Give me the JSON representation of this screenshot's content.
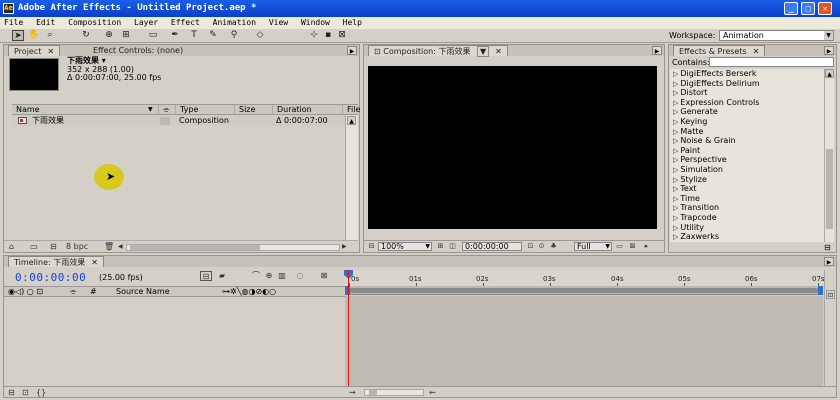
{
  "window": {
    "title": "Adobe After Effects - Untitled Project.aep *",
    "controls": [
      "minimize",
      "maximize",
      "close"
    ]
  },
  "menu": [
    "File",
    "Edit",
    "Composition",
    "Layer",
    "Effect",
    "Animation",
    "View",
    "Window",
    "Help"
  ],
  "toolbar": {
    "tools": [
      "selection-tool",
      "hand-tool",
      "zoom-tool",
      "rotation-tool",
      "orbit-camera-tool",
      "pan-behind-tool",
      "rectangle-mask-tool",
      "pen-tool",
      "text-tool",
      "brush-tool",
      "clone-stamp-tool",
      "eraser-tool",
      "axis-mode-local",
      "axis-mode-world",
      "axis-mode-view"
    ],
    "workspace_label": "Workspace:",
    "workspace_value": "Animation"
  },
  "project_panel": {
    "tab_project": "Project",
    "tab_effect_controls": "Effect Controls: (none)",
    "selected_name": "下雨效果 ▾",
    "selected_size": "352 x 288 (1.00)",
    "selected_duration": "Δ 0:00:07:00, 25.00 fps",
    "columns": [
      "Name",
      "Type",
      "Size",
      "Duration",
      "File"
    ],
    "items": [
      {
        "name": "下雨效果",
        "type": "Composition",
        "size": "",
        "duration": "Δ 0:00:07:00"
      }
    ],
    "bit_depth": "8 bpc"
  },
  "composition_panel": {
    "tab": "Composition: 下雨效果",
    "zoom": "100%",
    "timecode": "0:00:00:00",
    "resolution": "Full"
  },
  "effects_panel": {
    "tab": "Effects & Presets",
    "contains_label": "Contains:",
    "contains_value": "",
    "items": [
      "DigiEffects Berserk",
      "DigiEffects Delirium",
      "Distort",
      "Expression Controls",
      "Generate",
      "Keying",
      "Matte",
      "Noise & Grain",
      "Paint",
      "Perspective",
      "Simulation",
      "Stylize",
      "Text",
      "Time",
      "Transition",
      "Trapcode",
      "Utility",
      "Zaxwerks"
    ]
  },
  "timeline": {
    "tab": "Timeline: 下雨效果",
    "current_time": "0:00:00:00",
    "fps": "(25.00 fps)",
    "column_source_name": "Source Name",
    "column_number": "#",
    "ruler_labels": [
      "0s",
      "01s",
      "02s",
      "03s",
      "04s",
      "05s",
      "06s",
      "07s"
    ]
  },
  "colors": {
    "titlebar": "#0a3fc8",
    "timecode": "#1a3fd6",
    "playhead": "#d11111",
    "panel_bg": "#d4d0c8"
  }
}
